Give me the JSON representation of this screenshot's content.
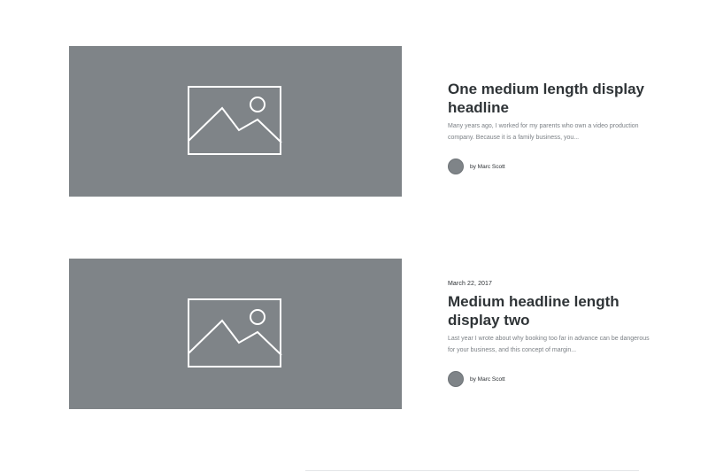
{
  "posts": [
    {
      "date": "",
      "headline": "One medium length display headline",
      "excerpt": "Many years ago, I worked for my parents who own a video production company. Because it is a family business, you...",
      "author": "by Marc Scott",
      "image_icon": "image-placeholder-icon"
    },
    {
      "date": "March 22, 2017",
      "headline": "Medium headline length display two",
      "excerpt": "Last year I wrote about why booking too far in advance can be dangerous for your business, and this concept of margin...",
      "author": "by Marc Scott",
      "image_icon": "image-placeholder-icon"
    }
  ],
  "colors": {
    "placeholder_bg": "#7f8488",
    "headline": "#2f3437",
    "excerpt": "#7c8186"
  }
}
